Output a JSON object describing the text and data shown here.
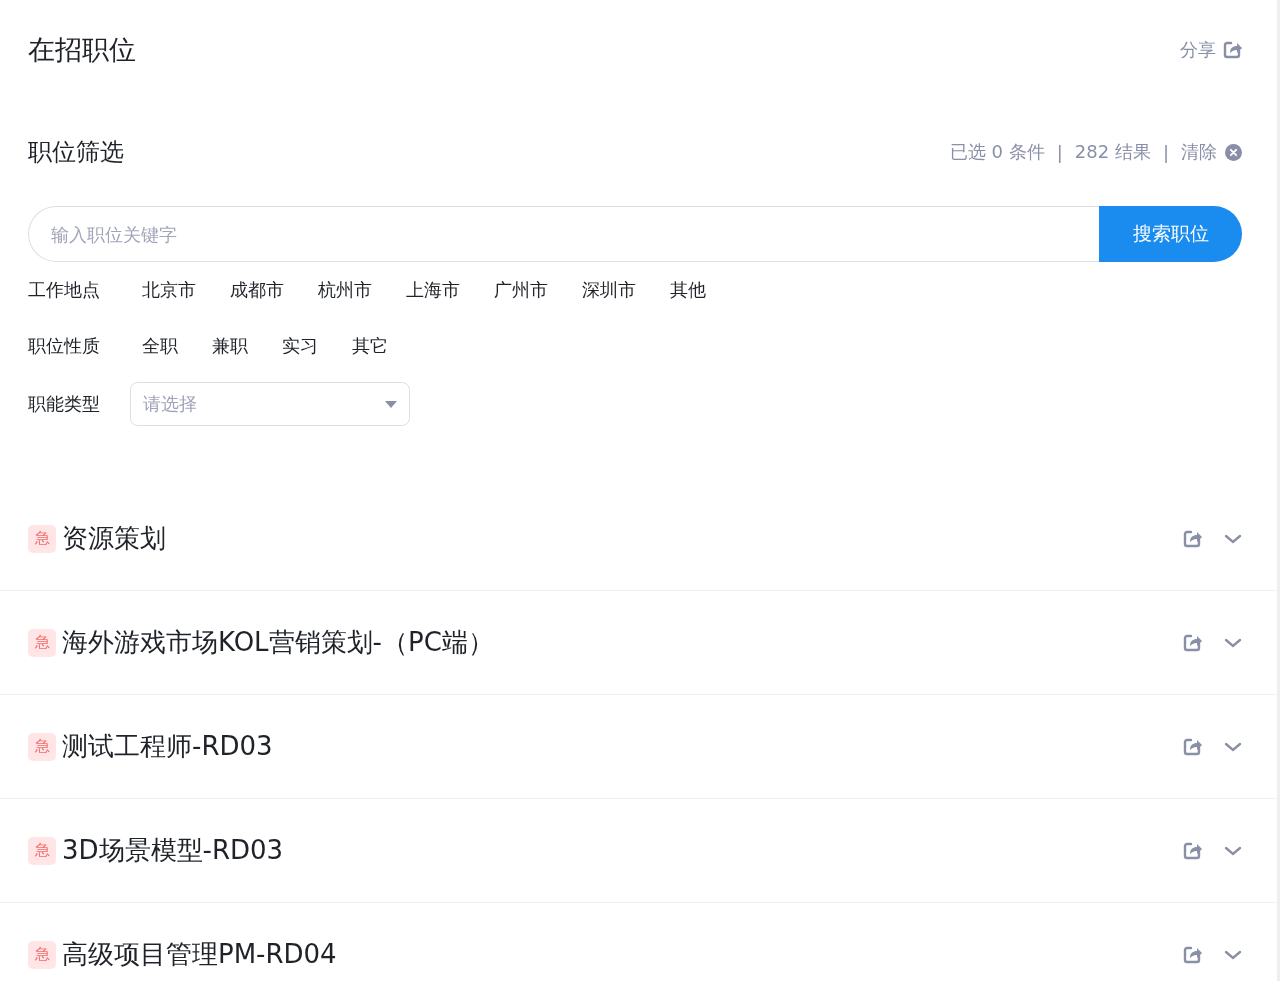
{
  "page_title": "在招职位",
  "share": {
    "label": "分享"
  },
  "filter_header": {
    "title": "职位筛选",
    "selected_count": "已选 0 条件",
    "separator_1": "|",
    "result_count": "282 结果",
    "separator_2": "|",
    "clear": "清除"
  },
  "search": {
    "placeholder": "输入职位关键字",
    "button": "搜索职位"
  },
  "filters": [
    {
      "label": "工作地点",
      "options": [
        "北京市",
        "成都市",
        "杭州市",
        "上海市",
        "广州市",
        "深圳市",
        "其他"
      ]
    },
    {
      "label": "职位性质",
      "options": [
        "全职",
        "兼职",
        "实习",
        "其它"
      ]
    }
  ],
  "function_type": {
    "label": "职能类型",
    "placeholder": "请选择"
  },
  "jobs": [
    {
      "badge": "急",
      "title": "资源策划"
    },
    {
      "badge": "急",
      "title": "海外游戏市场KOL营销策划-（PC端）"
    },
    {
      "badge": "急",
      "title": "测试工程师-RD03"
    },
    {
      "badge": "急",
      "title": "3D场景模型-RD03"
    },
    {
      "badge": "急",
      "title": "高级项目管理PM-RD04"
    }
  ]
}
